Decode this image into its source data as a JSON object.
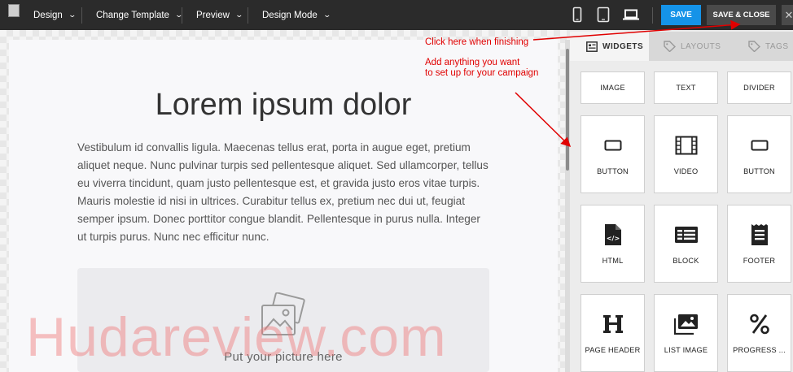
{
  "topbar": {
    "menus": [
      {
        "label": "Design"
      },
      {
        "label": "Change Template"
      },
      {
        "label": "Preview"
      },
      {
        "label": "Design Mode"
      }
    ],
    "devices": [
      "phone-icon",
      "tablet-icon",
      "desktop-icon"
    ],
    "save_label": "SAVE",
    "save_close_label": "SAVE & CLOSE",
    "close_icon": "close-icon"
  },
  "canvas": {
    "headline": "Lorem ipsum dolor",
    "body": "Vestibulum id convallis ligula. Maecenas tellus erat, porta in augue eget, pretium aliquet neque. Nunc pulvinar turpis sed pellentesque aliquet. Sed ullamcorper, tellus eu viverra tincidunt, quam justo pellentesque est, et gravida justo eros vitae turpis. Mauris molestie id nisi in ultrices. Curabitur tellus ex, pretium nec dui ut, feugiat semper ipsum. Donec porttitor congue blandit. Pellentesque in purus nulla. Integer ut turpis purus. Nunc nec efficitur nunc.",
    "picture_placeholder": "Put your picture here"
  },
  "panel": {
    "tabs": [
      {
        "label": "WIDGETS",
        "icon": "widgets-icon",
        "active": true
      },
      {
        "label": "LAYOUTS",
        "icon": "tag-icon",
        "active": false
      },
      {
        "label": "TAGS",
        "icon": "tag-icon",
        "active": false
      }
    ],
    "widgets": [
      {
        "label": "IMAGE",
        "icon": "image-icon"
      },
      {
        "label": "TEXT",
        "icon": "text-icon"
      },
      {
        "label": "DIVIDER",
        "icon": "divider-icon"
      },
      {
        "label": "BUTTON",
        "icon": "button-icon"
      },
      {
        "label": "VIDEO",
        "icon": "video-icon"
      },
      {
        "label": "BUTTON",
        "icon": "button-icon"
      },
      {
        "label": "HTML",
        "icon": "html-icon"
      },
      {
        "label": "BLOCK",
        "icon": "block-icon"
      },
      {
        "label": "FOOTER",
        "icon": "footer-icon"
      },
      {
        "label": "PAGE HEADER",
        "icon": "page-header-icon"
      },
      {
        "label": "LIST IMAGE",
        "icon": "list-image-icon"
      },
      {
        "label": "PROGRESS ...",
        "icon": "percent-icon"
      }
    ]
  },
  "annotations": {
    "finish_note": "Click here when finishing",
    "add_note_line1": "Add anything you want",
    "add_note_line2": "to set up for your campaign",
    "color": "#e00000"
  },
  "watermark": "Hudareview.com",
  "colors": {
    "topbar": "#2b2b2b",
    "save": "#1593e8",
    "save_close": "#4a4a4a"
  }
}
